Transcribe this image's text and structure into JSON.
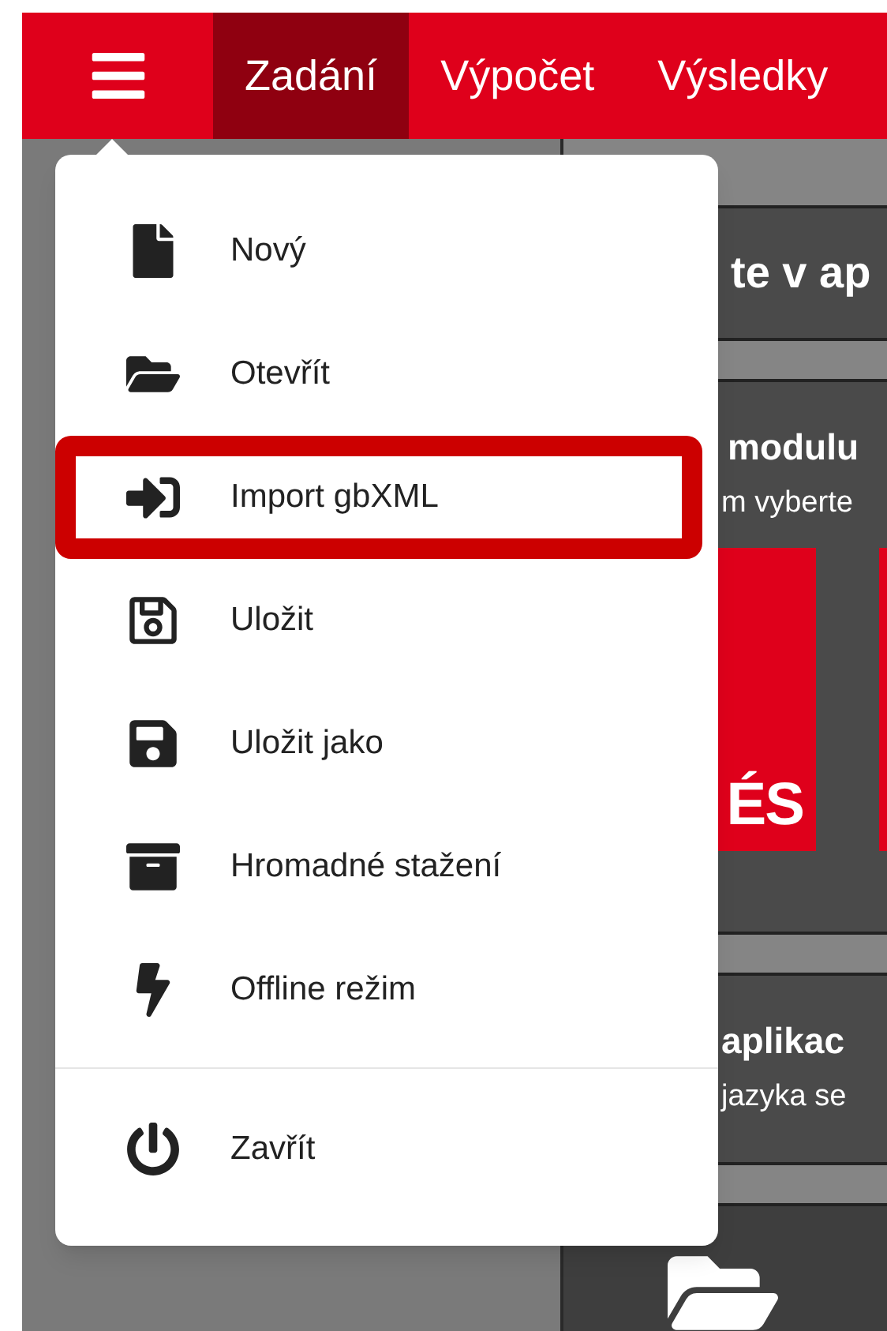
{
  "nav": {
    "tabs": [
      {
        "label": "Zadání",
        "selected": true
      },
      {
        "label": "Výpočet",
        "selected": false
      },
      {
        "label": "Výsledky",
        "selected": false
      }
    ]
  },
  "background": {
    "heading": "te v ap",
    "module_panel": {
      "title": "modulu",
      "text": "m vyberte",
      "tile_label": "ÉS"
    },
    "app_panel": {
      "title": "aplikac",
      "text": "jazyka se"
    }
  },
  "menu": {
    "groups": [
      [
        {
          "label": "Nový",
          "highlighted": false
        },
        {
          "label": "Otevřít",
          "highlighted": false
        },
        {
          "label": "Import gbXML",
          "highlighted": true
        },
        {
          "label": "Uložit",
          "highlighted": false
        },
        {
          "label": "Uložit jako",
          "highlighted": false
        },
        {
          "label": "Hromadné stažení",
          "highlighted": false
        },
        {
          "label": "Offline režim",
          "highlighted": false
        }
      ],
      [
        {
          "label": "Zavřít",
          "highlighted": false
        }
      ]
    ]
  }
}
